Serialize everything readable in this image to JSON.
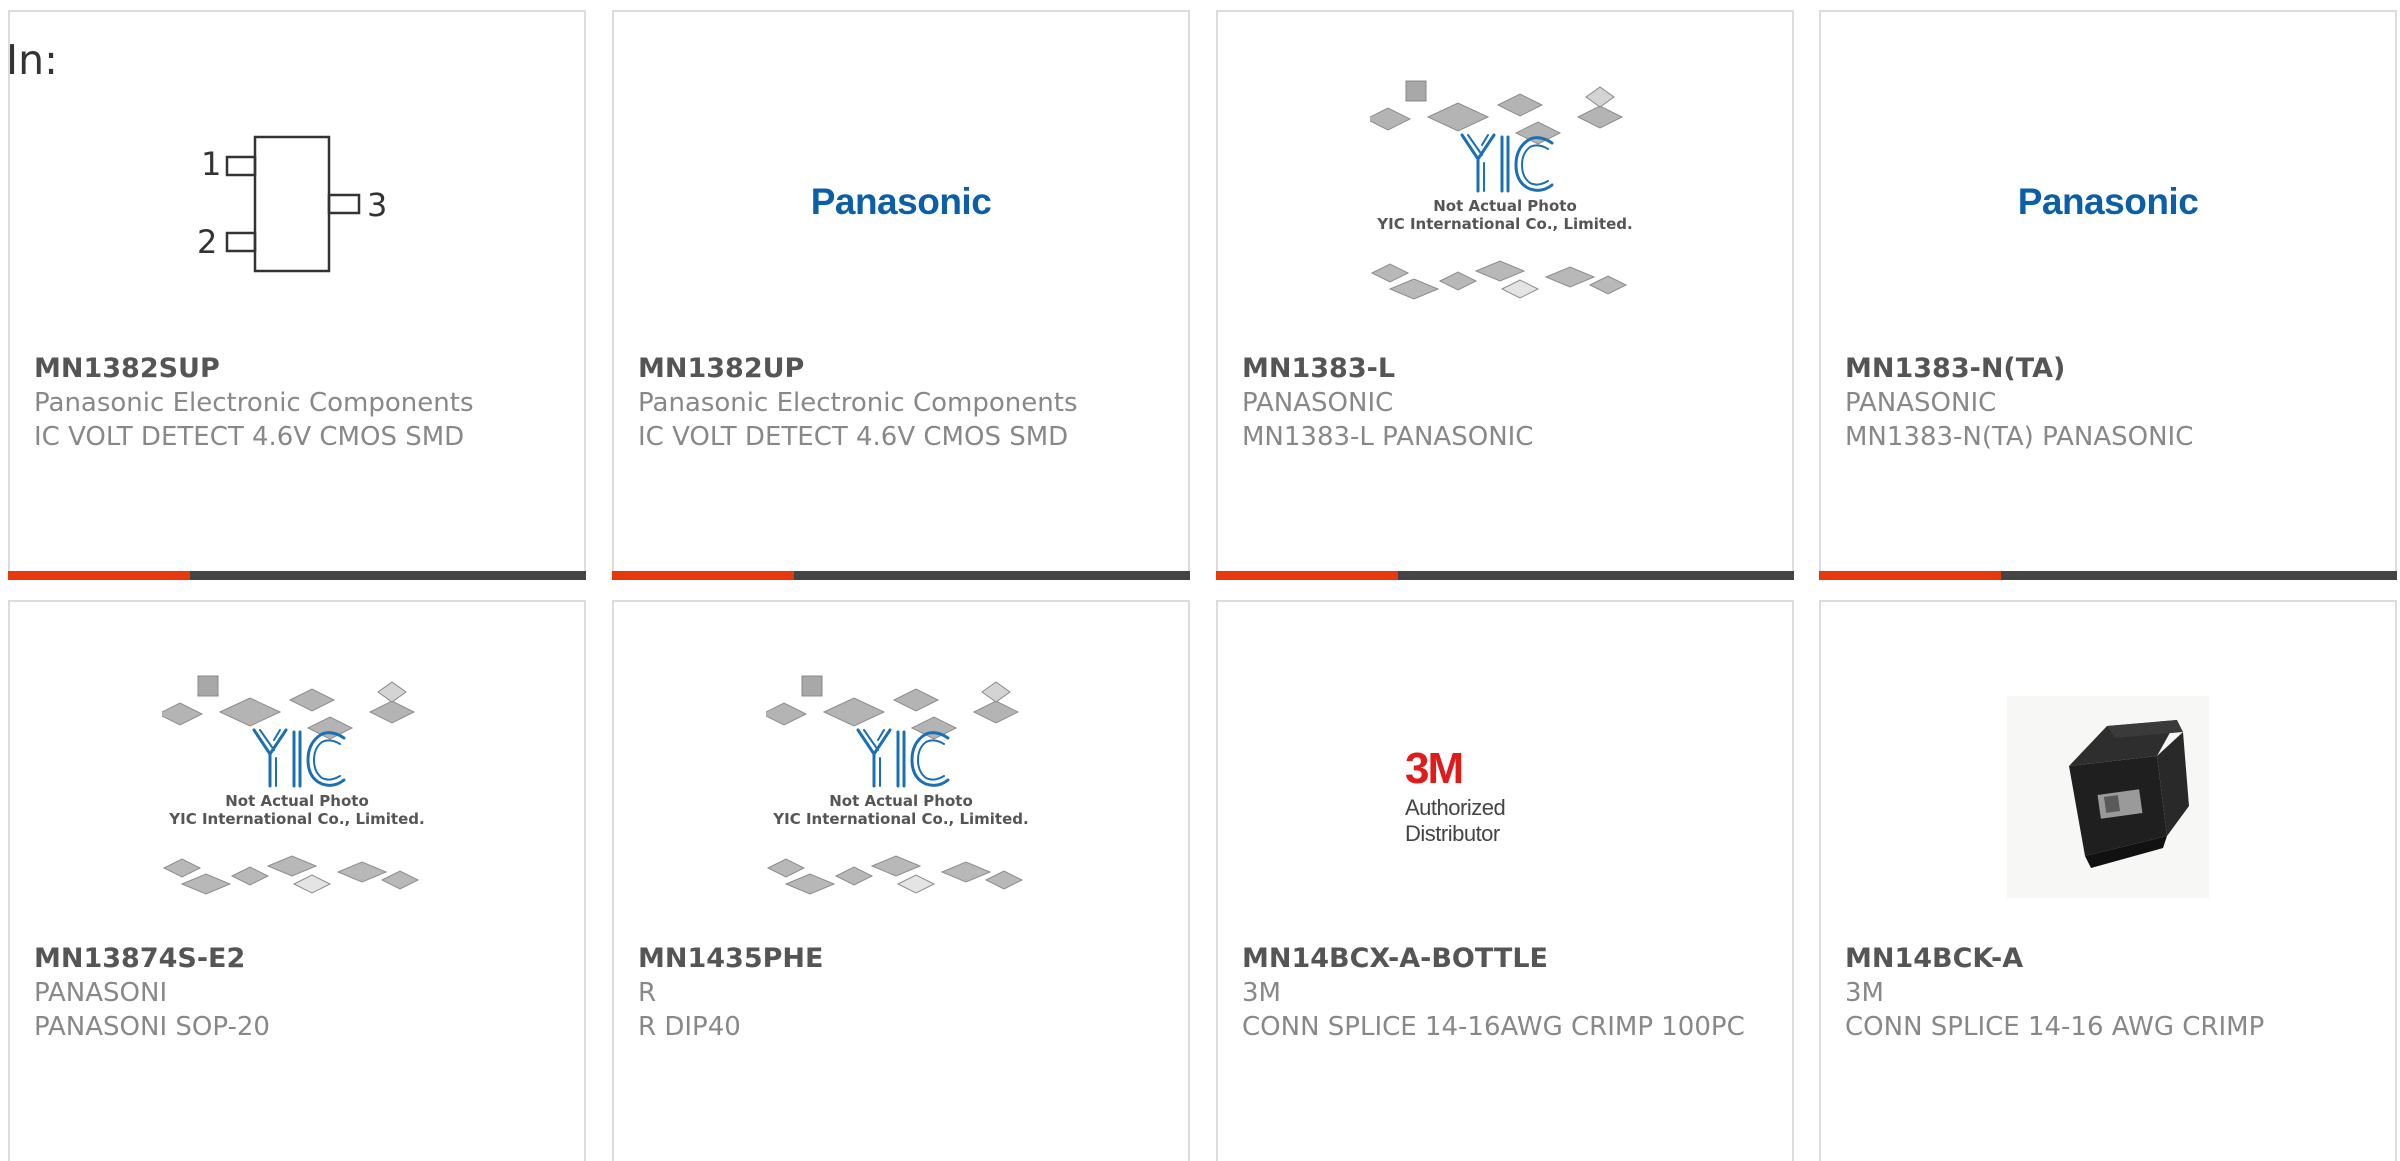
{
  "heading": {
    "label": "In:"
  },
  "placeholder": {
    "line1": "Not Actual Photo",
    "line2": "YIC International Co., Limited."
  },
  "logos": {
    "panasonic": "Panasonic",
    "threem": "3M",
    "threem_tagline": "Authorized Distributor",
    "yic": "YIC"
  },
  "schematic_pins": {
    "p1": "1",
    "p2": "2",
    "p3": "3"
  },
  "colors": {
    "accent": "#e8380d",
    "bar": "#444444",
    "panasonic_blue": "#0b5fa8",
    "threem_red": "#e01b1b"
  },
  "products": [
    {
      "part": "MN1382SUP",
      "manufacturer": "Panasonic Electronic Components",
      "description": "IC VOLT DETECT 4.6V CMOS SMD",
      "image": "sot23-schematic"
    },
    {
      "part": "MN1382UP",
      "manufacturer": "Panasonic Electronic Components",
      "description": "IC VOLT DETECT 4.6V CMOS SMD",
      "image": "panasonic-logo"
    },
    {
      "part": "MN1383-L",
      "manufacturer": "PANASONIC",
      "description": "MN1383-L PANASONIC",
      "image": "yic-placeholder"
    },
    {
      "part": "MN1383-N(TA)",
      "manufacturer": "PANASONIC",
      "description": "MN1383-N(TA) PANASONIC",
      "image": "panasonic-logo"
    },
    {
      "part": "MN13874S-E2",
      "manufacturer": "PANASONI",
      "description": "PANASONI SOP-20",
      "image": "yic-placeholder"
    },
    {
      "part": "MN1435PHE",
      "manufacturer": "R",
      "description": "R DIP40",
      "image": "yic-placeholder"
    },
    {
      "part": "MN14BCX-A-BOTTLE",
      "manufacturer": "3M",
      "description": "CONN SPLICE 14-16AWG CRIMP 100PC",
      "image": "3m-logo"
    },
    {
      "part": "MN14BCK-A",
      "manufacturer": "3M",
      "description": "CONN SPLICE 14-16 AWG CRIMP",
      "image": "splice-photo"
    }
  ]
}
